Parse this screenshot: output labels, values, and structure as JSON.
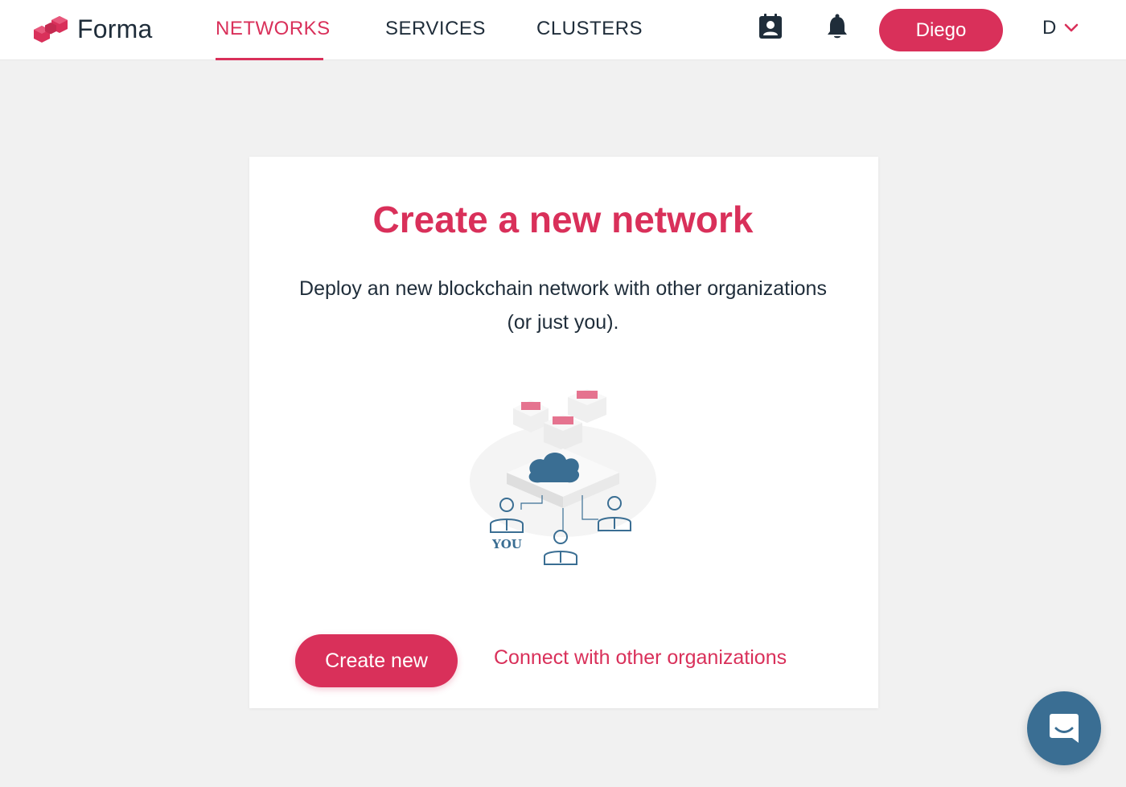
{
  "app": {
    "brand": "Forma",
    "accent_color": "#d9305a",
    "chat_color": "#3a6e93"
  },
  "nav": {
    "tabs": [
      {
        "label": "NETWORKS",
        "active": true
      },
      {
        "label": "SERVICES",
        "active": false
      },
      {
        "label": "CLUSTERS",
        "active": false
      }
    ],
    "icons": [
      "contacts-icon",
      "bell-icon"
    ],
    "user_button": "Diego",
    "account_initial": "D"
  },
  "card": {
    "title": "Create a new network",
    "description_line1": "Deploy an new blockchain network with other organizations",
    "description_line2": "(or just you).",
    "illustration_label": "YOU",
    "primary_button": "Create new",
    "secondary_link": "Connect with other organizations"
  }
}
